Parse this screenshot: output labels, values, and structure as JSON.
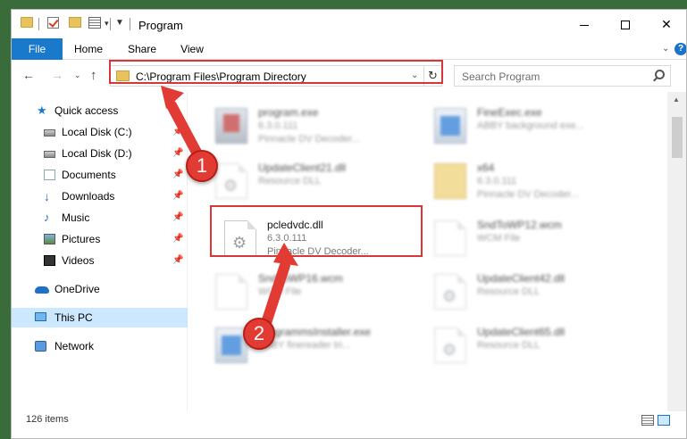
{
  "window": {
    "title": "Program",
    "minimize_glyph": "",
    "close_glyph": "✕"
  },
  "ribbon": {
    "tabs": [
      {
        "label": "File"
      },
      {
        "label": "Home"
      },
      {
        "label": "Share"
      },
      {
        "label": "View"
      }
    ]
  },
  "address": {
    "path": "C:\\Program Files\\Program Directory",
    "search_placeholder": "Search Program"
  },
  "navigation": {
    "quick_access": "Quick access",
    "items": [
      {
        "label": "Local Disk (C:)"
      },
      {
        "label": "Local Disk (D:)"
      },
      {
        "label": "Documents"
      },
      {
        "label": "Downloads"
      },
      {
        "label": "Music"
      },
      {
        "label": "Pictures"
      },
      {
        "label": "Videos"
      }
    ],
    "onedrive": "OneDrive",
    "this_pc": "This PC",
    "network": "Network"
  },
  "files": [
    {
      "name": "program.exe",
      "line2": "6.3.0.111",
      "line3": "Pinnacle DV Decoder..."
    },
    {
      "name": "FineExec.exe",
      "line2": "ABBY background exe...",
      "line3": ""
    },
    {
      "name": "UpdateClient21.dll",
      "line2": "Resource DLL",
      "line3": ""
    },
    {
      "name": "x64",
      "line2": "6.3.0.111",
      "line3": "Pinnacle DV Decoder..."
    },
    {
      "name": "pcledvdc.dll",
      "line2": "6.3.0.111",
      "line3": "Pinnacle DV Decoder..."
    },
    {
      "name": "SndToWP12.wcm",
      "line2": "WCM File",
      "line3": ""
    },
    {
      "name": "SndToWP16.wcm",
      "line2": "WCM File",
      "line3": ""
    },
    {
      "name": "UpdateClient42.dll",
      "line2": "Resource DLL",
      "line3": ""
    },
    {
      "name": "ProgrammsInstaller.exe",
      "line2": "ABBY finereader tri...",
      "line3": ""
    },
    {
      "name": "UpdateClient65.dll",
      "line2": "Resource DLL",
      "line3": ""
    }
  ],
  "status": {
    "item_count": "126 items"
  },
  "annotations": {
    "badge_1": "1",
    "badge_2": "2",
    "color": "#e23b33"
  }
}
